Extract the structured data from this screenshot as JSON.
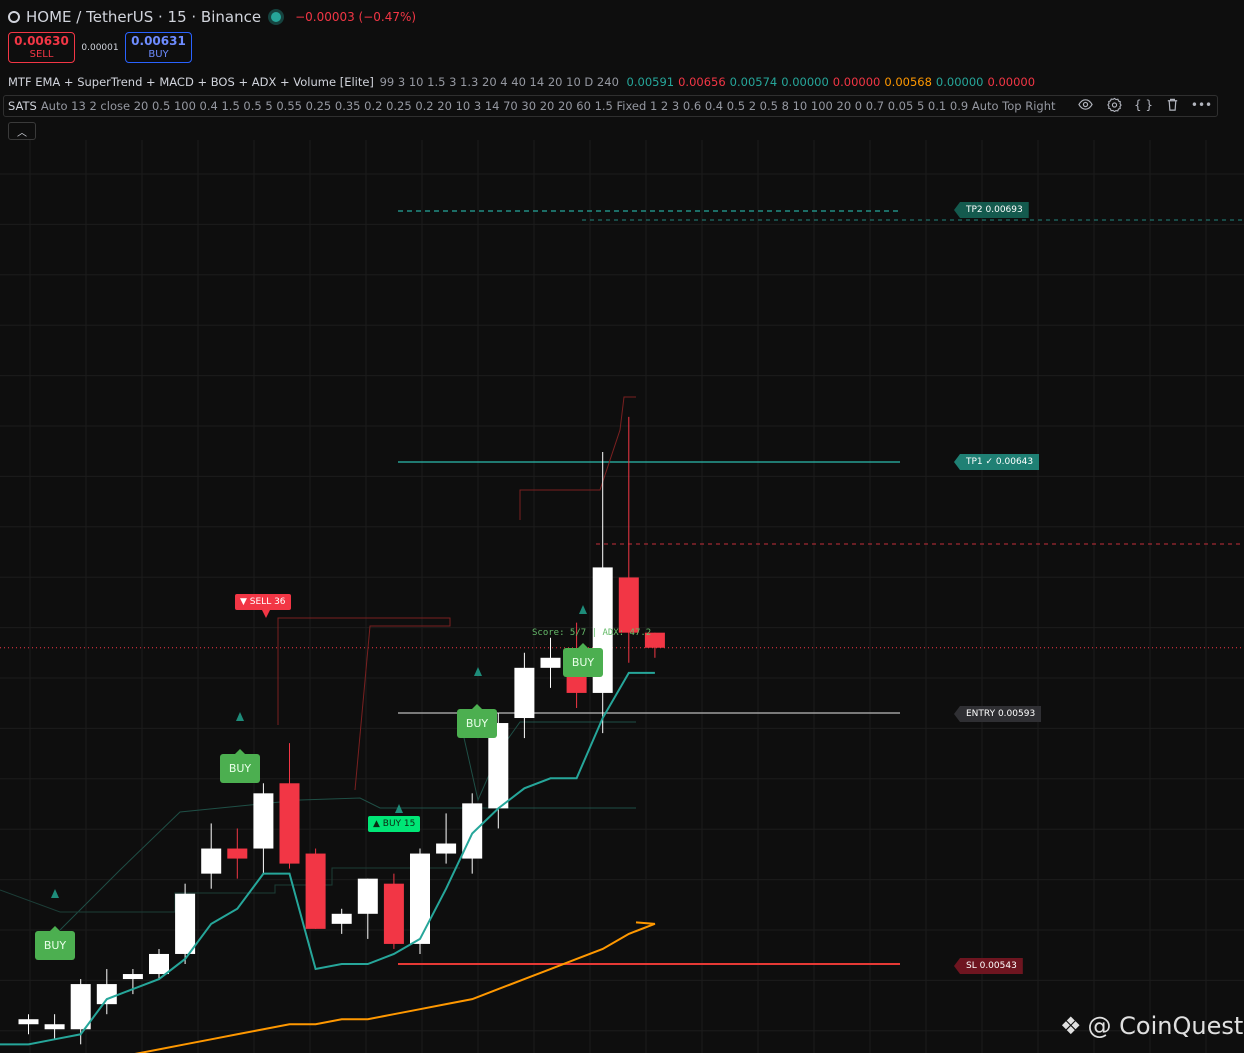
{
  "symbol_bar": {
    "title": "HOME / TetherUS · 15 · Binance",
    "change": "−0.00003 (−0.47%)"
  },
  "trade": {
    "sell_price": "0.00630",
    "sell_label": "SELL",
    "spread": "0.00001",
    "buy_price": "0.00631",
    "buy_label": "BUY"
  },
  "indicator1": {
    "name": "MTF EMA + SuperTrend + MACD + BOS + ADX + Volume [Elite]",
    "params": "99 3 10 1.5 3 1.3 20 4 40 14 20 10 D 240",
    "values": [
      {
        "text": "0.00591",
        "color": "#26a69a"
      },
      {
        "text": "0.00656",
        "color": "#f23645"
      },
      {
        "text": "0.00574",
        "color": "#26a69a"
      },
      {
        "text": "0.00000",
        "color": "#26a69a"
      },
      {
        "text": "0.00000",
        "color": "#f23645"
      },
      {
        "text": "0.00568",
        "color": "#ff9800"
      },
      {
        "text": "0.00000",
        "color": "#26a69a"
      },
      {
        "text": "0.00000",
        "color": "#f23645"
      }
    ]
  },
  "indicator2": {
    "name": "SATS",
    "params": "Auto 13 2 close 20 0.5 100 0.4 1.5 0.5 5 0.55 0.25 0.35 0.2 0.25 0.2 20 10 3 14 70 30 20 20 60 1.5 Fixed 1 2 3 0.6 0.4 0.5 2 0.5 8 10 100 20 0 0.7 0.05 5 0.1 0.9 Auto Top Right"
  },
  "levels": {
    "tp2": "TP2 0.00693",
    "tp1": "TP1 ✓ 0.00643",
    "entry": "ENTRY 0.00593",
    "sl": "SL 0.00543"
  },
  "markers": {
    "sell": "▼ SELL 36",
    "buy": "▲ BUY 15",
    "buy_box": "BUY",
    "score": "Score: 5/7 | ADX: 47.2"
  },
  "watermark": "@ CoinQuest",
  "colors": {
    "up": "#ffffff",
    "down": "#f23645",
    "supertrend": "#26a69a",
    "ema": "#ff9800",
    "tp": "#26a69a",
    "sl": "#c62828",
    "buy_box": "#4caf50",
    "buy_label": "#00e676",
    "sell_label": "#f23645"
  },
  "chart_data": {
    "type": "candlestick",
    "candles": [
      {
        "o": 0.00531,
        "h": 0.00533,
        "l": 0.00529,
        "c": 0.00532
      },
      {
        "o": 0.0053,
        "h": 0.00533,
        "l": 0.00528,
        "c": 0.00531
      },
      {
        "o": 0.0053,
        "h": 0.0054,
        "l": 0.00527,
        "c": 0.00539
      },
      {
        "o": 0.00535,
        "h": 0.00542,
        "l": 0.00533,
        "c": 0.00539
      },
      {
        "o": 0.0054,
        "h": 0.00542,
        "l": 0.00537,
        "c": 0.00541
      },
      {
        "o": 0.00541,
        "h": 0.00546,
        "l": 0.0054,
        "c": 0.00545
      },
      {
        "o": 0.00545,
        "h": 0.00559,
        "l": 0.00543,
        "c": 0.00557
      },
      {
        "o": 0.00561,
        "h": 0.00571,
        "l": 0.00558,
        "c": 0.00566
      },
      {
        "o": 0.00566,
        "h": 0.0057,
        "l": 0.0056,
        "c": 0.00564
      },
      {
        "o": 0.00566,
        "h": 0.00579,
        "l": 0.00561,
        "c": 0.00577
      },
      {
        "o": 0.00579,
        "h": 0.00587,
        "l": 0.00562,
        "c": 0.00563
      },
      {
        "o": 0.00565,
        "h": 0.00566,
        "l": 0.0055,
        "c": 0.0055
      },
      {
        "o": 0.00551,
        "h": 0.00554,
        "l": 0.00549,
        "c": 0.00553
      },
      {
        "o": 0.00553,
        "h": 0.0056,
        "l": 0.00548,
        "c": 0.0056
      },
      {
        "o": 0.00559,
        "h": 0.00561,
        "l": 0.00546,
        "c": 0.00547
      },
      {
        "o": 0.00547,
        "h": 0.00566,
        "l": 0.00545,
        "c": 0.00565
      },
      {
        "o": 0.00565,
        "h": 0.00573,
        "l": 0.00563,
        "c": 0.00567
      },
      {
        "o": 0.00564,
        "h": 0.00577,
        "l": 0.00561,
        "c": 0.00575
      },
      {
        "o": 0.00574,
        "h": 0.00593,
        "l": 0.0057,
        "c": 0.00591
      },
      {
        "o": 0.00592,
        "h": 0.00605,
        "l": 0.00588,
        "c": 0.00602
      },
      {
        "o": 0.00602,
        "h": 0.00608,
        "l": 0.00598,
        "c": 0.00604
      },
      {
        "o": 0.00604,
        "h": 0.00611,
        "l": 0.00594,
        "c": 0.00597
      },
      {
        "o": 0.00597,
        "h": 0.00645,
        "l": 0.00589,
        "c": 0.00622
      },
      {
        "o": 0.0062,
        "h": 0.00652,
        "l": 0.00603,
        "c": 0.00609
      },
      {
        "o": 0.00609,
        "h": 0.00609,
        "l": 0.00604,
        "c": 0.00606
      }
    ],
    "supertrend": [
      0.00527,
      0.00528,
      0.00529,
      0.00536,
      0.00538,
      0.0054,
      0.00544,
      0.00551,
      0.00554,
      0.00561,
      0.00561,
      0.00542,
      0.00543,
      0.00543,
      0.00545,
      0.00548,
      0.00558,
      0.00569,
      0.00574,
      0.00578,
      0.0058,
      0.0058,
      0.00592,
      0.00601,
      0.00601
    ],
    "ema": [
      0.00521,
      0.00522,
      0.00523,
      0.00524,
      0.00525,
      0.00526,
      0.00527,
      0.00528,
      0.00529,
      0.0053,
      0.00531,
      0.00531,
      0.00532,
      0.00532,
      0.00533,
      0.00534,
      0.00535,
      0.00536,
      0.00538,
      0.0054,
      0.00542,
      0.00544,
      0.00546,
      0.00549,
      0.00551
    ],
    "current_price": 0.00606,
    "tp2": 0.00693,
    "tp1": 0.00643,
    "entry": 0.00593,
    "sl": 0.00543,
    "ylim": [
      0.00527,
      0.00668
    ],
    "grid": true
  }
}
